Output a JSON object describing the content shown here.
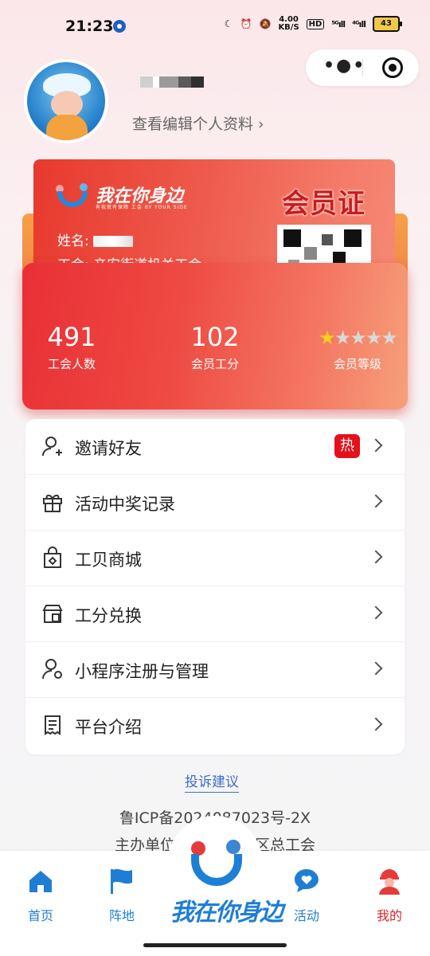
{
  "status_bar": {
    "time": "21:23",
    "speed_value": "4.00",
    "speed_unit": "KB/S",
    "hd_label": "HD",
    "signal_5g": "⁵ᴳıll",
    "signal_4g": "⁴ᴳıll",
    "battery": "43"
  },
  "profile": {
    "edit_link": "查看编辑个人资料 ›"
  },
  "card": {
    "logo_text": "我在你身边",
    "logo_sub": "有我就有保障 工会 BY YOUR SIDE",
    "title": "会员证",
    "name_label": "姓名:",
    "union_label": "工会:",
    "union_value": "辛安街道机关工会",
    "stats": [
      {
        "value": "491",
        "label": "工会人数"
      },
      {
        "value": "102",
        "label": "会员工分"
      },
      {
        "value": "",
        "label": "会员等级"
      }
    ],
    "level_stars": 1,
    "level_max": 5
  },
  "menu": {
    "items": [
      {
        "label": "邀请好友",
        "icon": "add-user-icon",
        "badge": "热"
      },
      {
        "label": "活动中奖记录",
        "icon": "gift-icon"
      },
      {
        "label": "工贝商城",
        "icon": "shopping-bag-icon"
      },
      {
        "label": "工分兑换",
        "icon": "store-exchange-icon"
      },
      {
        "label": "小程序注册与管理",
        "icon": "user-settings-icon"
      },
      {
        "label": "平台介绍",
        "icon": "document-icon"
      }
    ]
  },
  "footer": {
    "complaint_link": "投诉建议",
    "icp": "鲁ICP备2024087023号-2X",
    "sponsor_left": "主办单位",
    "sponsor_right": "区总工会"
  },
  "tabbar": {
    "tabs": [
      {
        "label": "首页",
        "icon": "home-icon"
      },
      {
        "label": "阵地",
        "icon": "flag-icon"
      },
      {
        "label": "我在你身边",
        "icon": "center-logo-icon"
      },
      {
        "label": "活动",
        "icon": "chat-heart-icon"
      },
      {
        "label": "我的",
        "icon": "worker-avatar-icon"
      }
    ]
  },
  "colors": {
    "accent_blue": "#1f7ed4",
    "card_red": "#e8392e",
    "hot_badge": "#e5101b",
    "active_tab": "#d8242b"
  }
}
